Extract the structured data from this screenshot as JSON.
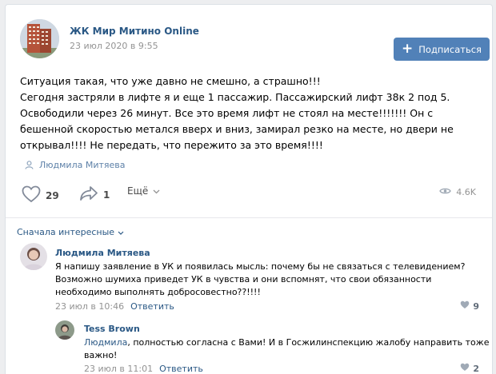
{
  "post": {
    "group_name": "ЖК Мир Митино Online",
    "date": "23 июл 2020 в 9:55",
    "subscribe_label": "Подписаться",
    "text_lines": [
      "Ситуация такая, что уже давно не смешно, а страшно!!!",
      "Сегодня застряли в лифте я и еще 1 пассажир. Пассажирский лифт 38к 2 под 5.",
      "Освободили через 26 минут. Все это время лифт не стоял на месте!!!!!!! Он с",
      "бешенной скоростью метался вверх и вниз, замирал резко на месте, но двери не",
      "открывал!!!! Не передать, что пережито за это время!!!!"
    ],
    "signer": "Людмила Митяева",
    "likes": "29",
    "shares": "1",
    "more_label": "Ещё",
    "views": "4.6K"
  },
  "comments": {
    "sort_label": "Сначала интересные",
    "items": [
      {
        "author": "Людмила Митяева",
        "text_lines": [
          "Я напишу заявление в УК и появилась мысль: почему бы не связаться с телевидением?",
          "Возможно шумиха приведет УК в чувства и они вспомнят, что свои обязанности",
          "необходимо выполнять добросовестно??!!!!"
        ],
        "date": "23 июл в 10:46",
        "reply_label": "Ответить",
        "likes": "9"
      },
      {
        "author": "Tess Brown",
        "mention": "Людмила",
        "text_first": ", полностью согласна с Вами! И в Госжилинспекцию жалобу направить тоже",
        "text_second": "важно!",
        "date": "23 июл в 11:01",
        "reply_label": "Ответить",
        "likes": "2"
      }
    ]
  },
  "icons": {
    "like": "heart-icon",
    "share": "share-arrow-icon",
    "views": "eye-icon",
    "signer": "user-icon",
    "more": "chevron-down-icon"
  },
  "colors": {
    "link": "#2a5885",
    "button": "#5181b8",
    "muted": "#939393",
    "background": "#edeef0"
  }
}
